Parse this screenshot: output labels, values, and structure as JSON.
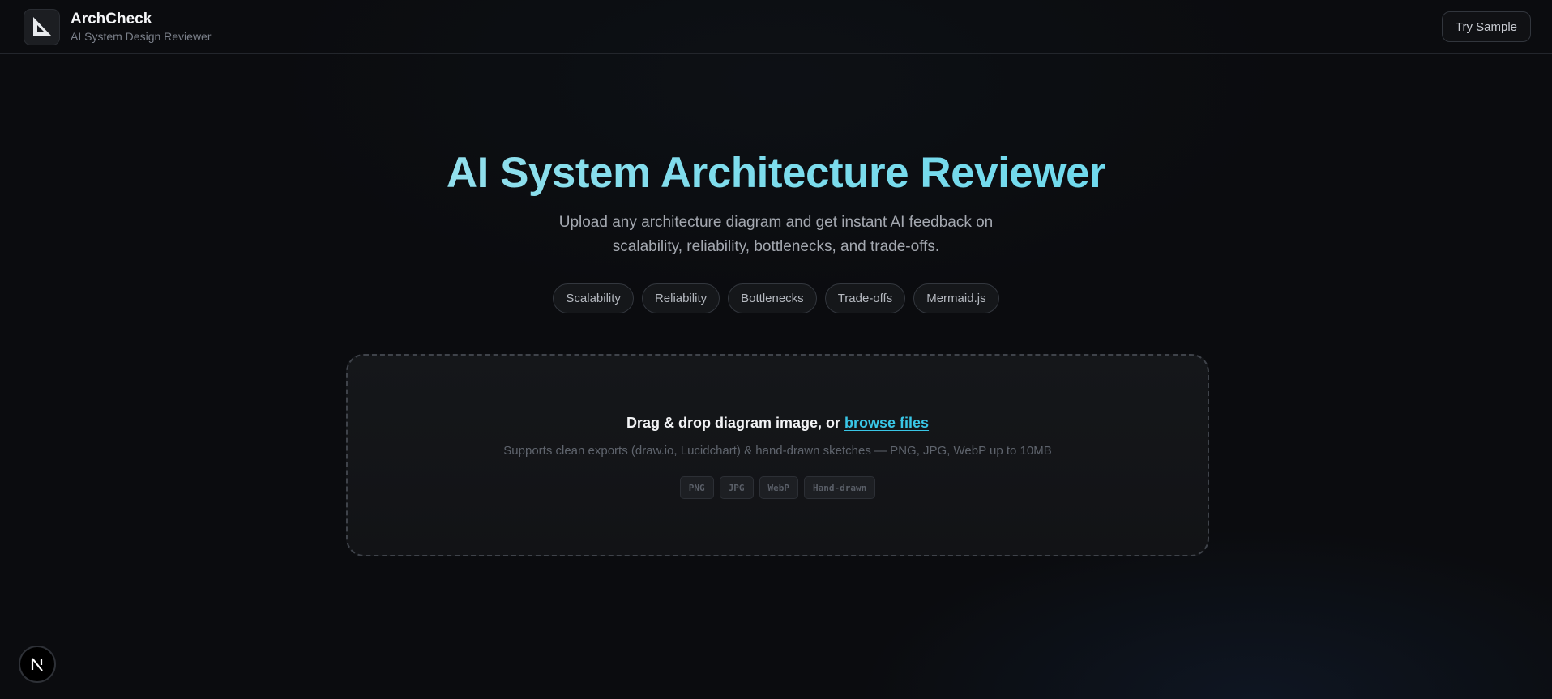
{
  "header": {
    "app_name": "ArchCheck",
    "app_subtitle": "AI System Design Reviewer",
    "logo_icon": "set-square-icon",
    "try_sample_label": "Try Sample"
  },
  "hero": {
    "title": "AI System Architecture Reviewer",
    "subtitle_line1": "Upload any architecture diagram and get instant AI feedback on",
    "subtitle_line2": "scalability, reliability, bottlenecks, and trade-offs.",
    "tags": [
      "Scalability",
      "Reliability",
      "Bottlenecks",
      "Trade-offs",
      "Mermaid.js"
    ]
  },
  "upload": {
    "prompt": "Drag & drop diagram image, or",
    "browse_label": "browse files",
    "hint": "Supports clean exports (draw.io, Lucidchart) & hand-drawn sketches — PNG, JPG, WebP up to 10MB",
    "formats": [
      "PNG",
      "JPG",
      "WebP",
      "Hand-drawn"
    ]
  },
  "dev_badge": {
    "icon": "nextjs-icon",
    "letter": "N"
  },
  "colors": {
    "background": "#0b0c0f",
    "accent": "#39c6e6",
    "title_gradient_start": "#b3e4ee",
    "title_gradient_end": "#5fd6ee"
  }
}
